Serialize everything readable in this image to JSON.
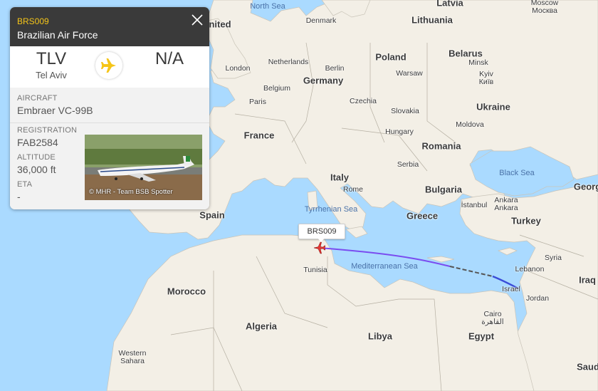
{
  "flight": {
    "callsign": "BRS009",
    "operator": "Brazilian Air Force",
    "origin_code": "TLV",
    "origin_city": "Tel Aviv",
    "destination_code": "N/A",
    "aircraft_label": "AIRCRAFT",
    "aircraft": "Embraer VC-99B",
    "registration_label": "REGISTRATION",
    "registration": "FAB2584",
    "altitude_label": "ALTITUDE",
    "altitude": "36,000 ft",
    "eta_label": "ETA",
    "eta": "-",
    "photo_credit": "© MHR - Team BSB Spotter"
  },
  "map_label": "BRS009",
  "colors": {
    "panel_header": "#3a3a3a",
    "callsign": "#f5c518",
    "plane_icon": "#f5c518",
    "track": "#7a4cf0",
    "aircraft_marker": "#e53935",
    "sea": "#aadaff",
    "land": "#f3efe6"
  },
  "labels": {
    "north_sea": "North Sea",
    "latvia": "Latvia",
    "moscow": "Moscow\nМосква",
    "united_kingdom": "nited",
    "denmark": "Denmark",
    "lithuania": "Lithuania",
    "london": "London",
    "netherlands": "Netherlands",
    "berlin": "Berlin",
    "poland": "Poland",
    "belarus": "Belarus",
    "minsk": "Minsk",
    "germany": "Germany",
    "warsaw": "Warsaw",
    "belgium": "Belgium",
    "kyiv": "Kyiv\nКиїв",
    "czechia": "Czechia",
    "paris": "Paris",
    "slovakia": "Slovakia",
    "ukraine": "Ukraine",
    "hungary": "Hungary",
    "moldova": "Moldova",
    "france": "France",
    "romania": "Romania",
    "serbia": "Serbia",
    "black_sea": "Black Sea",
    "italy": "Italy",
    "rome": "Rome",
    "bulgaria": "Bulgaria",
    "georgia": "Georg",
    "istanbul": "İstanbul",
    "ankara": "Ankara\nAnkara",
    "tyrrhenian": "Tyrrhenian Sea",
    "spain": "Spain",
    "greece": "Greece",
    "turkey": "Turkey",
    "syria": "Syria",
    "tunisia": "Tunisia",
    "mediterranean": "Mediterranean Sea",
    "lebanon": "Lebanon",
    "iraq": "Iraq",
    "morocco": "Morocco",
    "israel": "Israel",
    "jordan": "Jordan",
    "cairo": "Cairo\nالقاهرة",
    "algeria": "Algeria",
    "libya": "Libya",
    "egypt": "Egypt",
    "western_sahara": "Western\nSahara",
    "saudi": "Saud"
  },
  "icons": {
    "close": "close-icon",
    "plane": "airplane-icon"
  }
}
